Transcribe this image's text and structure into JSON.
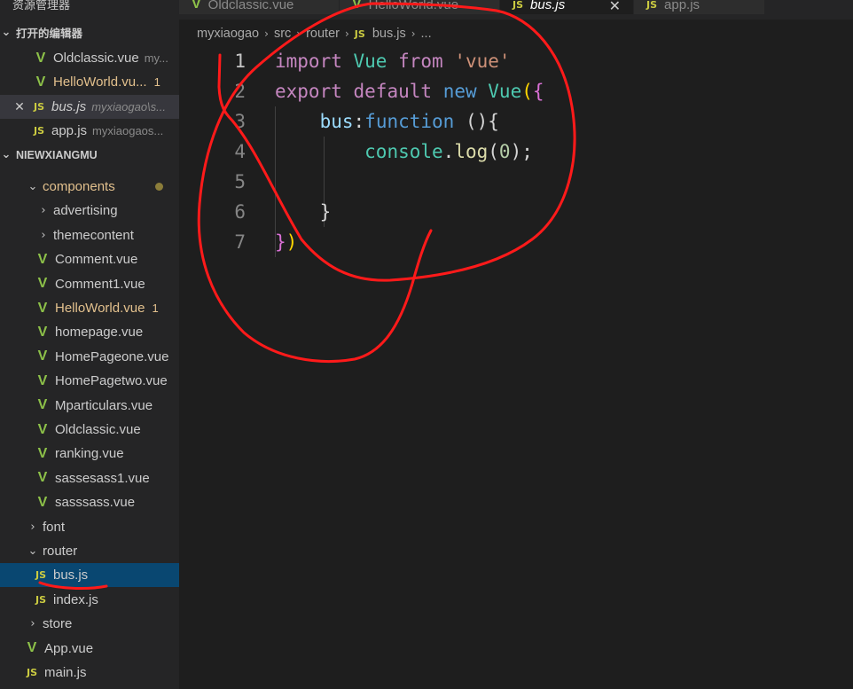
{
  "sidebar": {
    "top_title": "资源管理器",
    "open_editors_header": "打开的编辑器",
    "open_editors": [
      {
        "name": "Oldclassic.vue",
        "desc": "my...",
        "icon": "vue-icon"
      },
      {
        "name": "HelloWorld.vu...",
        "badge": "1",
        "icon": "vue-icon"
      },
      {
        "name": "bus.js",
        "desc": "myxiaogao\\s...",
        "icon": "js-icon",
        "close": "✕"
      },
      {
        "name": "app.js",
        "desc": "myxiaogaos...",
        "icon": "js-icon"
      }
    ],
    "project_header": "NIEWXIANGMU",
    "tree": [
      {
        "label": "components",
        "kind": "folder-open"
      },
      {
        "label": "advertising",
        "kind": "folder"
      },
      {
        "label": "themecontent",
        "kind": "folder"
      },
      {
        "label": "Comment.vue",
        "kind": "vue"
      },
      {
        "label": "Comment1.vue",
        "kind": "vue"
      },
      {
        "label": "HelloWorld.vue",
        "kind": "vue",
        "badge": "1"
      },
      {
        "label": "homepage.vue",
        "kind": "vue"
      },
      {
        "label": "HomePageone.vue",
        "kind": "vue"
      },
      {
        "label": "HomePagetwo.vue",
        "kind": "vue"
      },
      {
        "label": "Mparticulars.vue",
        "kind": "vue"
      },
      {
        "label": "Oldclassic.vue",
        "kind": "vue"
      },
      {
        "label": "ranking.vue",
        "kind": "vue"
      },
      {
        "label": "sassesass1.vue",
        "kind": "vue"
      },
      {
        "label": "sasssass.vue",
        "kind": "vue"
      },
      {
        "label": "font",
        "kind": "folder"
      },
      {
        "label": "router",
        "kind": "folder-open"
      },
      {
        "label": "bus.js",
        "kind": "js"
      },
      {
        "label": "index.js",
        "kind": "js"
      },
      {
        "label": "store",
        "kind": "folder"
      },
      {
        "label": "App.vue",
        "kind": "vue"
      },
      {
        "label": "main.js",
        "kind": "js"
      }
    ]
  },
  "tabs": [
    {
      "label": "Oldclassic.vue",
      "icon": "vue-icon"
    },
    {
      "label": "HelloWorld.vue",
      "icon": "vue-icon"
    },
    {
      "label": "bus.js",
      "icon": "js-icon",
      "close": "✕"
    },
    {
      "label": "app.js",
      "icon": "js-icon"
    }
  ],
  "icons": {
    "vue": "V",
    "js": "JS",
    "chevron_right": "›",
    "chevron_down": "⌄"
  },
  "breadcrumb": [
    "myxiaogao",
    "src",
    "router",
    "bus.js",
    "..."
  ],
  "editor": {
    "line_numbers": [
      "1",
      "2",
      "3",
      "4",
      "5",
      "6",
      "7"
    ],
    "current_line": 1
  },
  "colors": {
    "annotation": "#ff1a1a",
    "accent": "#094771"
  }
}
